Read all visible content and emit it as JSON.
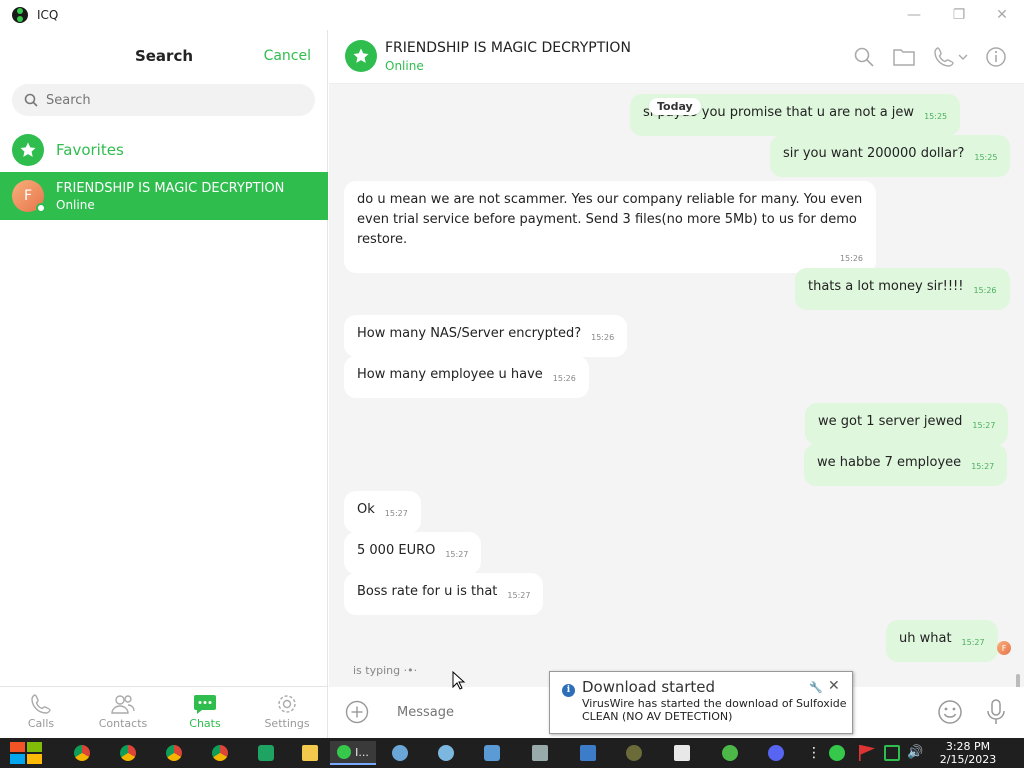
{
  "window": {
    "title": "ICQ"
  },
  "left": {
    "search_title": "Search",
    "cancel_label": "Cancel",
    "search_placeholder": "Search",
    "favorites_label": "Favorites",
    "contact": {
      "initial": "F",
      "name": "FRIENDSHIP IS MAGIC DECRYPTION",
      "status": "Online"
    },
    "nav": [
      {
        "label": "Calls",
        "icon": "phone-icon"
      },
      {
        "label": "Contacts",
        "icon": "contacts-icon"
      },
      {
        "label": "Chats",
        "icon": "chat-icon",
        "active": true
      },
      {
        "label": "Settings",
        "icon": "gear-icon"
      }
    ]
  },
  "chat": {
    "title": "FRIENDSHIP IS MAGIC DECRYPTION",
    "status": "Online",
    "today_label": "Today",
    "messages": [
      {
        "dir": "out",
        "text": "si paydo you promise that u are not a jew",
        "time": "15:25"
      },
      {
        "dir": "out",
        "text": "sir you want 200000 dollar?",
        "time": "15:25"
      },
      {
        "dir": "in",
        "text": "do u mean we are not scammer. Yes our company reliable for many. You even even trial service before payment. Send 3 files(no more 5Mb) to us for demo restore.",
        "time": "15:26"
      },
      {
        "dir": "out",
        "text": "thats a lot money sir!!!!",
        "time": "15:26"
      },
      {
        "dir": "in",
        "text": "How many NAS/Server encrypted?",
        "time": "15:26"
      },
      {
        "dir": "in",
        "text": "How many employee u have",
        "time": "15:26"
      },
      {
        "dir": "out",
        "text": "we got 1 server jewed",
        "time": "15:27"
      },
      {
        "dir": "out",
        "text": "we habbe 7 employee",
        "time": "15:27"
      },
      {
        "dir": "in",
        "text": "Ok",
        "time": "15:27"
      },
      {
        "dir": "in",
        "text": "5 000 EURO",
        "time": "15:27"
      },
      {
        "dir": "in",
        "text": "Boss rate for u is that",
        "time": "15:27"
      },
      {
        "dir": "out",
        "text": "uh what",
        "time": "15:27"
      }
    ],
    "reader_initial": "F",
    "typing": "is typing",
    "input_placeholder": "Message"
  },
  "notification": {
    "title": "Download started",
    "body": "VirusWire has started the download of Sulfoxide CLEAN (NO AV DETECTION)"
  },
  "taskbar": {
    "active_label": "I...",
    "clock_time": "3:28 PM",
    "clock_date": "2/15/2023"
  },
  "colors": {
    "accent": "#2fbd4e",
    "outgoing_bubble": "#dff7dd",
    "chat_bg": "#f4f4f4"
  }
}
